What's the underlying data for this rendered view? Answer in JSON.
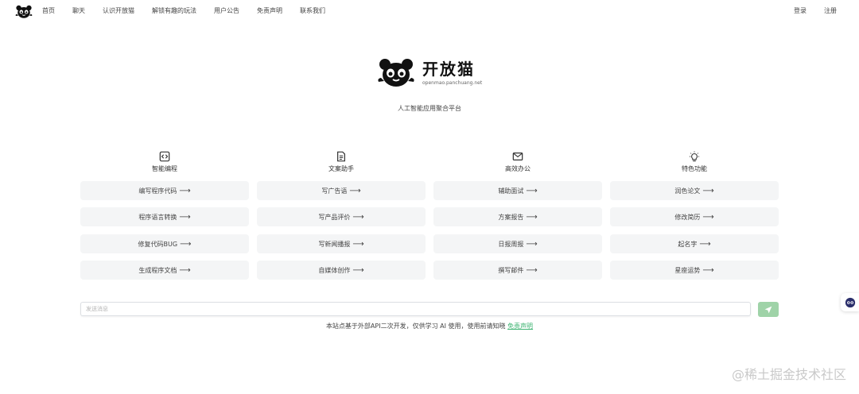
{
  "nav": {
    "links": [
      "首页",
      "聊天",
      "认识开放猫",
      "解锁有趣的玩法",
      "用户公告",
      "免责声明",
      "联系我们"
    ],
    "login": "登录",
    "register": "注册"
  },
  "brand": {
    "name": "开放猫",
    "url": "openmao.panchuang.net",
    "tagline": "人工智能应用聚合平台"
  },
  "categories": [
    {
      "title": "智能编程",
      "icon": "code-icon",
      "items": [
        "编写程序代码",
        "程序语言转换",
        "修复代码BUG",
        "生成程序文档"
      ]
    },
    {
      "title": "文案助手",
      "icon": "document-icon",
      "items": [
        "写广告语",
        "写产品评价",
        "写新闻播报",
        "自媒体创作"
      ]
    },
    {
      "title": "高效办公",
      "icon": "mail-icon",
      "items": [
        "辅助面试",
        "方案报告",
        "日报周报",
        "撰写邮件"
      ]
    },
    {
      "title": "特色功能",
      "icon": "lightbulb-icon",
      "items": [
        "润色论文",
        "修改简历",
        "起名字",
        "星座运势"
      ]
    }
  ],
  "arrow": "⟶",
  "chat": {
    "placeholder": "发送消息",
    "value": ""
  },
  "footer": {
    "text": "本站点基于外部API二次开发，仅供学习 AI 使用，使用前请知晓",
    "link": "免责声明"
  },
  "watermark": "@稀土掘金技术社区",
  "colors": {
    "accent": "#9fd3a8",
    "link": "#3cb371"
  }
}
